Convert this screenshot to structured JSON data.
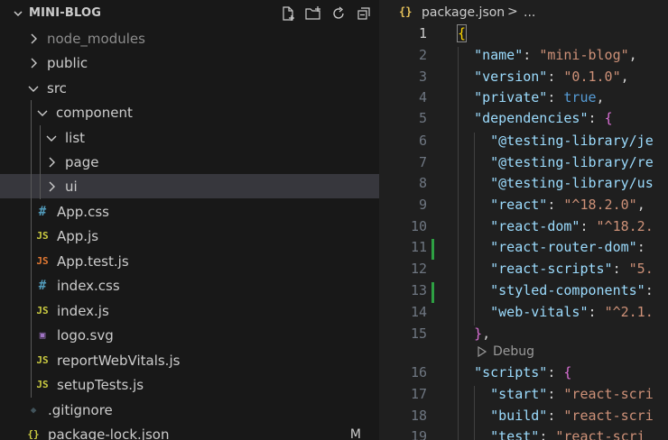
{
  "explorer": {
    "title": "MINI-BLOG",
    "tree": [
      {
        "label": "node_modules",
        "kind": "folder",
        "open": false,
        "depth": 1,
        "dim": true
      },
      {
        "label": "public",
        "kind": "folder",
        "open": false,
        "depth": 1
      },
      {
        "label": "src",
        "kind": "folder",
        "open": true,
        "depth": 1
      },
      {
        "label": "component",
        "kind": "folder",
        "open": true,
        "depth": 2
      },
      {
        "label": "list",
        "kind": "folder",
        "open": true,
        "depth": 3
      },
      {
        "label": "page",
        "kind": "folder",
        "open": false,
        "depth": 3
      },
      {
        "label": "ui",
        "kind": "folder",
        "open": false,
        "depth": 3,
        "selected": true
      },
      {
        "label": "App.css",
        "kind": "css",
        "depth": 2
      },
      {
        "label": "App.js",
        "kind": "js",
        "depth": 2
      },
      {
        "label": "App.test.js",
        "kind": "test",
        "depth": 2
      },
      {
        "label": "index.css",
        "kind": "css",
        "depth": 2
      },
      {
        "label": "index.js",
        "kind": "js",
        "depth": 2
      },
      {
        "label": "logo.svg",
        "kind": "svg",
        "depth": 2
      },
      {
        "label": "reportWebVitals.js",
        "kind": "js",
        "depth": 2
      },
      {
        "label": "setupTests.js",
        "kind": "js",
        "depth": 2
      },
      {
        "label": ".gitignore",
        "kind": "git",
        "depth": 1
      },
      {
        "label": "package-lock.json",
        "kind": "json",
        "depth": 1,
        "badge": "M"
      }
    ],
    "icons": {
      "css": "#",
      "js": "JS",
      "test": "JS",
      "json": "{}",
      "git": "◆",
      "svg": "▣"
    },
    "icon_colors": {
      "css": "#519aba",
      "js": "#cbcb41",
      "test": "#e37933",
      "json": "#cbcb41",
      "git": "#41535b",
      "svg": "#a074c4"
    },
    "actions": [
      "new-file-icon",
      "new-folder-icon",
      "refresh-icon",
      "collapse-all-icon"
    ]
  },
  "editor": {
    "breadcrumb": {
      "icon": "{}",
      "file": "package.json",
      "sep": ">",
      "more": "..."
    },
    "active_line": 1,
    "modified_lines": [
      11,
      13
    ],
    "code_lens": "Debug",
    "lines": [
      {
        "n": "1",
        "parts": [
          [
            "b1",
            "{"
          ]
        ]
      },
      {
        "n": "2",
        "parts": [
          [
            "p",
            "  "
          ],
          [
            "k",
            "\"name\""
          ],
          [
            "p",
            ": "
          ],
          [
            "s",
            "\"mini-blog\""
          ],
          [
            "p",
            ","
          ]
        ]
      },
      {
        "n": "3",
        "parts": [
          [
            "p",
            "  "
          ],
          [
            "k",
            "\"version\""
          ],
          [
            "p",
            ": "
          ],
          [
            "s",
            "\"0.1.0\""
          ],
          [
            "p",
            ","
          ]
        ]
      },
      {
        "n": "4",
        "parts": [
          [
            "p",
            "  "
          ],
          [
            "k",
            "\"private\""
          ],
          [
            "p",
            ": "
          ],
          [
            "kw",
            "true"
          ],
          [
            "p",
            ","
          ]
        ]
      },
      {
        "n": "5",
        "parts": [
          [
            "p",
            "  "
          ],
          [
            "k",
            "\"dependencies\""
          ],
          [
            "p",
            ": "
          ],
          [
            "b2",
            "{"
          ]
        ]
      },
      {
        "n": "6",
        "parts": [
          [
            "p",
            "    "
          ],
          [
            "k",
            "\"@testing-library/je"
          ]
        ]
      },
      {
        "n": "7",
        "parts": [
          [
            "p",
            "    "
          ],
          [
            "k",
            "\"@testing-library/re"
          ]
        ]
      },
      {
        "n": "8",
        "parts": [
          [
            "p",
            "    "
          ],
          [
            "k",
            "\"@testing-library/us"
          ]
        ]
      },
      {
        "n": "9",
        "parts": [
          [
            "p",
            "    "
          ],
          [
            "k",
            "\"react\""
          ],
          [
            "p",
            ": "
          ],
          [
            "s",
            "\"^18.2.0\""
          ],
          [
            "p",
            ","
          ]
        ]
      },
      {
        "n": "10",
        "parts": [
          [
            "p",
            "    "
          ],
          [
            "k",
            "\"react-dom\""
          ],
          [
            "p",
            ": "
          ],
          [
            "s",
            "\"^18.2."
          ]
        ]
      },
      {
        "n": "11",
        "parts": [
          [
            "p",
            "    "
          ],
          [
            "k",
            "\"react-router-dom\""
          ],
          [
            "p",
            ":"
          ]
        ]
      },
      {
        "n": "12",
        "parts": [
          [
            "p",
            "    "
          ],
          [
            "k",
            "\"react-scripts\""
          ],
          [
            "p",
            ": "
          ],
          [
            "s",
            "\"5."
          ]
        ]
      },
      {
        "n": "13",
        "parts": [
          [
            "p",
            "    "
          ],
          [
            "k",
            "\"styled-components\""
          ],
          [
            "p",
            ":"
          ]
        ]
      },
      {
        "n": "14",
        "parts": [
          [
            "p",
            "    "
          ],
          [
            "k",
            "\"web-vitals\""
          ],
          [
            "p",
            ": "
          ],
          [
            "s",
            "\"^2.1."
          ]
        ]
      },
      {
        "n": "15",
        "parts": [
          [
            "p",
            "  "
          ],
          [
            "b2",
            "}"
          ],
          [
            "p",
            ","
          ]
        ]
      },
      {
        "n": "16",
        "parts": [
          [
            "p",
            "  "
          ],
          [
            "k",
            "\"scripts\""
          ],
          [
            "p",
            ": "
          ],
          [
            "b2",
            "{"
          ]
        ]
      },
      {
        "n": "17",
        "parts": [
          [
            "p",
            "    "
          ],
          [
            "k",
            "\"start\""
          ],
          [
            "p",
            ": "
          ],
          [
            "s",
            "\"react-scri"
          ]
        ]
      },
      {
        "n": "18",
        "parts": [
          [
            "p",
            "    "
          ],
          [
            "k",
            "\"build\""
          ],
          [
            "p",
            ": "
          ],
          [
            "s",
            "\"react-scri"
          ]
        ]
      },
      {
        "n": "19",
        "parts": [
          [
            "p",
            "    "
          ],
          [
            "k",
            "\"test\""
          ],
          [
            "p",
            ": "
          ],
          [
            "s",
            "\"react-scri"
          ]
        ]
      }
    ]
  }
}
